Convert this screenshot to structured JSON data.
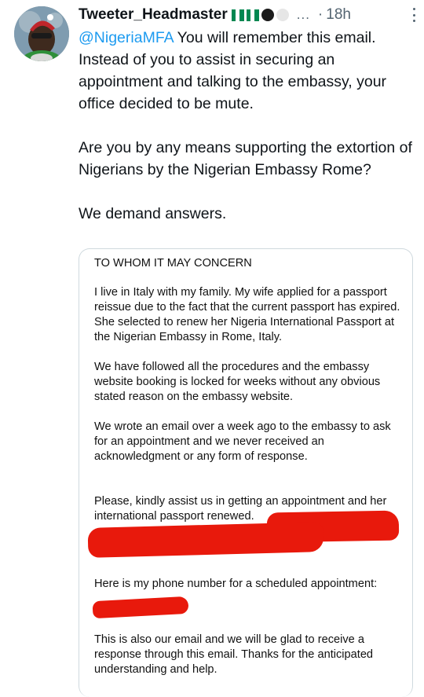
{
  "tweet": {
    "username": "Tweeter_Headmaster",
    "more": "...",
    "separator": "·",
    "time": "18h",
    "mention": "@NigeriaMFA",
    "para1_rest": " You will remember this email. Instead of you to assist in securing an appointment and talking to the embassy, your office decided to be mute.",
    "para2": "Are you by any means supporting the extortion of Nigerians by the Nigerian Embassy Rome?",
    "para3": "We demand answers."
  },
  "emojis": [
    "nigeria-flag",
    "nigeria-flag",
    "black-circle",
    "white-circle"
  ],
  "colors": {
    "mention": "#1d9bf0",
    "flag_green": "#008751",
    "redaction": "#e8190c"
  },
  "letter": {
    "title": "TO WHOM IT MAY CONCERN",
    "p1": "I live in Italy with my family. My wife applied for a passport reissue due to the fact that the current passport has expired. She selected to renew her Nigeria International Passport at the Nigerian Embassy in Rome, Italy.",
    "p2": "We have followed all the procedures and the embassy website booking is locked for weeks without any obvious stated reason on the embassy website.",
    "p3": "We wrote an email over a week ago to the embassy to ask for an appointment and we never received an acknowledgment or any form of response.",
    "p4": "Please, kindly assist us in getting an appointment and her international passport renewed.",
    "p5": "Here is my phone number for a scheduled appointment:",
    "p6": "This is also our email and we will be glad to receive a response through this email. Thanks for the anticipated understanding and help."
  }
}
